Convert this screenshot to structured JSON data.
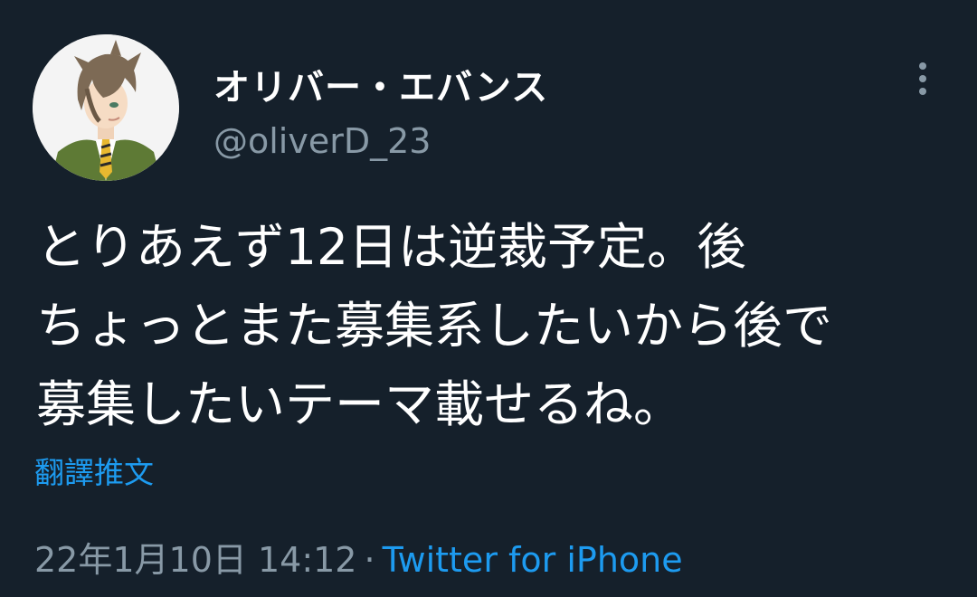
{
  "tweet": {
    "display_name": "オリバー・エバンス",
    "handle": "@oliverD_23",
    "text_lines": [
      "とりあえず12日は逆裁予定。後",
      "ちょっとまた募集系したいから後で",
      "募集したいテーマ載せるね。"
    ],
    "translate_label": "翻譯推文",
    "timestamp": "22年1月10日 14:12",
    "separator": "·",
    "source": "Twitter for iPhone"
  },
  "icons": {
    "more": "more-vertical-icon",
    "avatar": "profile-avatar"
  },
  "colors": {
    "background": "#15202b",
    "text": "#ffffff",
    "secondary_text": "#8899a6",
    "link": "#1d9bf0"
  }
}
